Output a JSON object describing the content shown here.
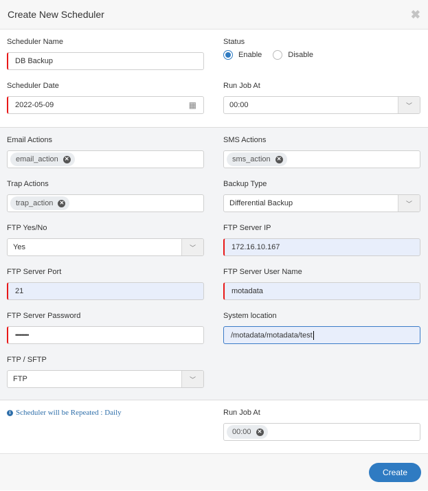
{
  "header": {
    "title": "Create New Scheduler",
    "close_icon": "close-icon"
  },
  "general": {
    "scheduler_name": {
      "label": "Scheduler Name",
      "value": "DB Backup"
    },
    "status": {
      "label": "Status",
      "options": [
        {
          "label": "Enable",
          "checked": true
        },
        {
          "label": "Disable",
          "checked": false
        }
      ]
    },
    "scheduler_date": {
      "label": "Scheduler Date",
      "value": "2022-05-09",
      "icon": "calendar-icon"
    },
    "run_job_at": {
      "label": "Run Job At",
      "value": "00:00"
    }
  },
  "actions": {
    "email_actions": {
      "label": "Email Actions",
      "tags": [
        "email_action"
      ]
    },
    "sms_actions": {
      "label": "SMS Actions",
      "tags": [
        "sms_action"
      ]
    },
    "trap_actions": {
      "label": "Trap Actions",
      "tags": [
        "trap_action"
      ]
    },
    "backup_type": {
      "label": "Backup Type",
      "value": "Differential Backup"
    },
    "ftp_yes_no": {
      "label": "FTP Yes/No",
      "value": "Yes"
    },
    "ftp_server_ip": {
      "label": "FTP Server IP",
      "value": "172.16.10.167"
    },
    "ftp_server_port": {
      "label": "FTP Server Port",
      "value": "21"
    },
    "ftp_server_user": {
      "label": "FTP Server User Name",
      "value": "motadata"
    },
    "ftp_server_password": {
      "label": "FTP Server Password",
      "value": "•••••••••"
    },
    "system_location": {
      "label": "System location",
      "value": "/motadata/motadata/test"
    },
    "ftp_sftp": {
      "label": "FTP / SFTP",
      "value": "FTP"
    }
  },
  "repeat": {
    "info_text": "Scheduler will be Repeated : Daily",
    "run_job_at": {
      "label": "Run Job At",
      "tags": [
        "00:00"
      ]
    }
  },
  "footer": {
    "create_label": "Create"
  },
  "colors": {
    "accent": "#2f7bc2",
    "required": "#e81818",
    "info": "#2f6faa",
    "filled_bg": "#e8eefb"
  }
}
